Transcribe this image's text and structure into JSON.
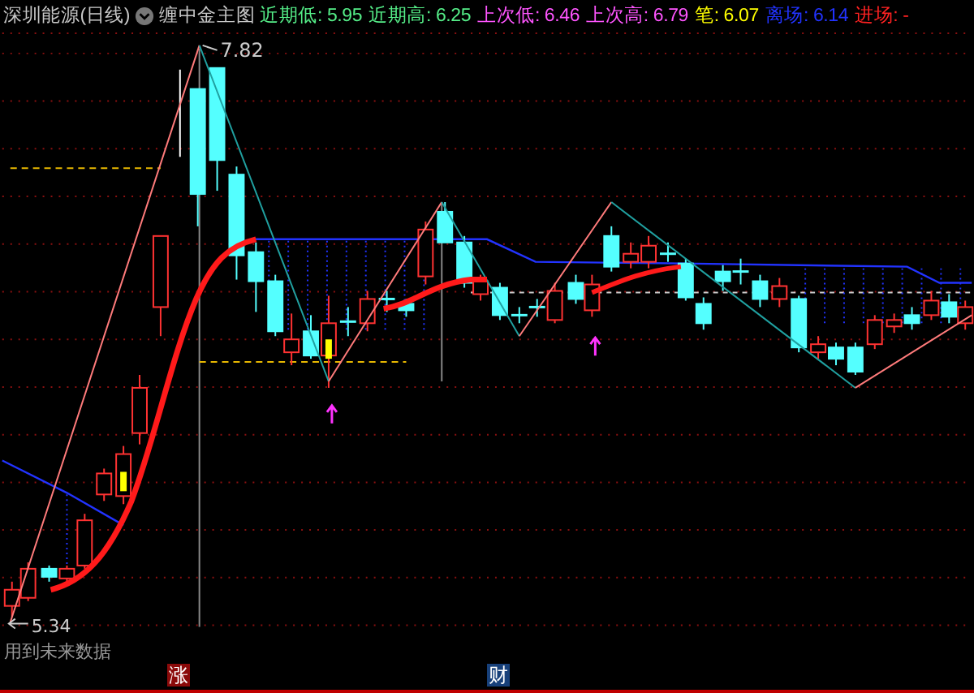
{
  "title": "深圳能源(日线)",
  "indicator": "缠中金主图",
  "readings": [
    {
      "text": "近期低: 5.95",
      "color": "#55ee88"
    },
    {
      "text": "近期高: 6.25",
      "color": "#55ee88"
    },
    {
      "text": "上次低: 6.46",
      "color": "#ff55ff"
    },
    {
      "text": "上次高: 6.79",
      "color": "#ff55ff"
    },
    {
      "text": "笔: 6.07",
      "color": "#ffff00"
    },
    {
      "text": "离场: 6.14",
      "color": "#2233ff"
    },
    {
      "text": "进场: -",
      "color": "#ff2222"
    }
  ],
  "chart": {
    "high_label": "7.82",
    "low_label": "5.34",
    "note": "用到未来数据"
  },
  "markers": [
    {
      "label": "涨",
      "color": "#8b0a0a"
    },
    {
      "label": "财",
      "color": "#17407a"
    }
  ]
}
